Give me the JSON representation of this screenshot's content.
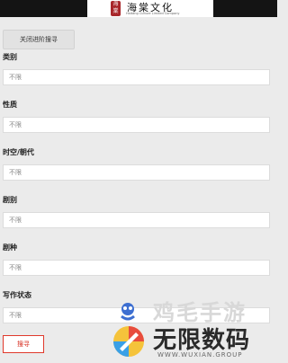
{
  "header": {
    "logo_seal": "海棠",
    "logo_title": "海棠文化",
    "logo_subtitle": "Haitang Culture Limited Company"
  },
  "close_advanced_search_label": "关闭进阶搜寻",
  "filters": [
    {
      "label": "类别",
      "value": "不限"
    },
    {
      "label": "性质",
      "value": "不限"
    },
    {
      "label": "时空/朝代",
      "value": "不限"
    },
    {
      "label": "剧别",
      "value": "不限"
    },
    {
      "label": "剧种",
      "value": "不限"
    },
    {
      "label": "写作状态",
      "value": "不限"
    }
  ],
  "search_button_label": "搜寻",
  "watermark": {
    "gray_text": "鸡毛手游",
    "main_text": "无限数码",
    "url": "WWW.WUXIAN.GROUP"
  },
  "colors": {
    "topbar": "#141414",
    "seal": "#a8262a",
    "search_border": "#e0392b"
  }
}
